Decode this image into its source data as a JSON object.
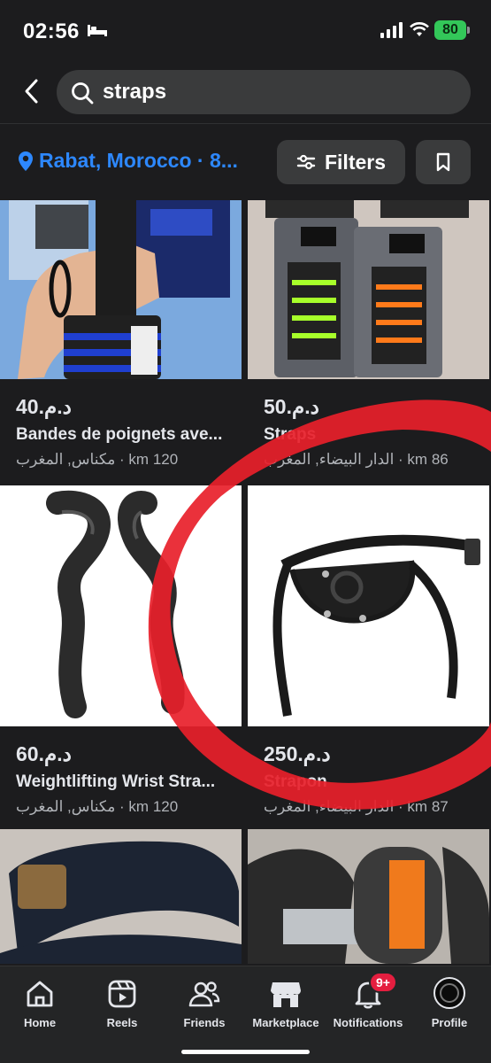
{
  "status_bar": {
    "time": "02:56",
    "battery": "80"
  },
  "search": {
    "value": "straps"
  },
  "location_bar": {
    "location": "Rabat, Morocco · 8...",
    "filters_label": "Filters"
  },
  "listings": [
    {
      "price": "د.م.40",
      "title": "Bandes de poignets ave...",
      "meta": "مكناس, المغرب · km 120"
    },
    {
      "price": "د.م.50",
      "title": "Straps",
      "meta": "الدار البيضاء, المغرب · km 86"
    },
    {
      "price": "د.م.60",
      "title": "Weightlifting Wrist Stra...",
      "meta": "مكناس, المغرب · km 120"
    },
    {
      "price": "د.م.250",
      "title": "Strapon",
      "meta": "الدار البيضاء, المغرب · km 87"
    }
  ],
  "bottom_nav": {
    "home": "Home",
    "reels": "Reels",
    "friends": "Friends",
    "marketplace": "Marketplace",
    "notifications": "Notifications",
    "notifications_badge": "9+",
    "profile": "Profile"
  },
  "colors": {
    "accent": "#2d88ff",
    "background": "#1c1c1e",
    "annotation": "#e8202a"
  }
}
